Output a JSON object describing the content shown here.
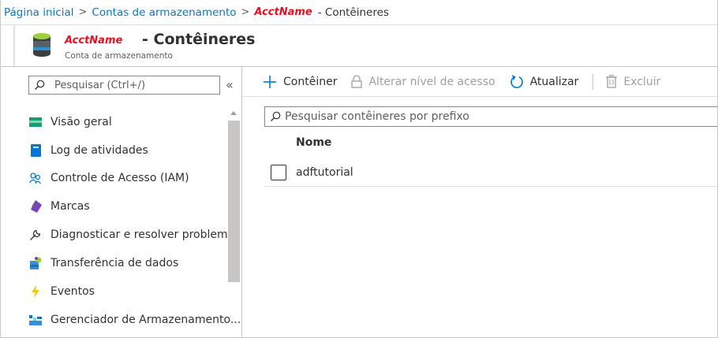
{
  "breadcrumb": {
    "home": "Página inicial",
    "storage_accounts": "Contas de armazenamento",
    "account": "AcctName",
    "current": "- Contêineres"
  },
  "header": {
    "account": "AcctName",
    "title": "- Contêineres",
    "subtitle": "Conta de armazenamento",
    "icon": "storage-account-icon"
  },
  "sidebar": {
    "search_placeholder": "Pesquisar (Ctrl+/)",
    "collapse": "«",
    "items": [
      {
        "label": "Visão geral",
        "icon": "overview-icon"
      },
      {
        "label": "Log de atividades",
        "icon": "activity-log-icon"
      },
      {
        "label": "Controle de Acesso (IAM)",
        "icon": "iam-icon"
      },
      {
        "label": "Marcas",
        "icon": "tags-icon"
      },
      {
        "label": "Diagnosticar e resolver problemas",
        "icon": "wrench-icon"
      },
      {
        "label": "Transferência de dados",
        "icon": "data-transfer-icon"
      },
      {
        "label": "Eventos",
        "icon": "lightning-icon"
      },
      {
        "label": "Gerenciador de Armazenamento...",
        "icon": "storage-explorer-icon"
      }
    ]
  },
  "toolbar": {
    "add_container": "Contêiner",
    "change_access": "Alterar nível de acesso",
    "refresh": "Atualizar",
    "delete": "Excluir"
  },
  "containers": {
    "search_placeholder": "Pesquisar contêineres por prefixo",
    "column_name": "Nome",
    "rows": [
      {
        "name": "adftutorial"
      }
    ]
  },
  "colors": {
    "accent": "#0078d4",
    "account_name": "#e81123",
    "text": "#323130",
    "disabled": "#a19f9d"
  }
}
